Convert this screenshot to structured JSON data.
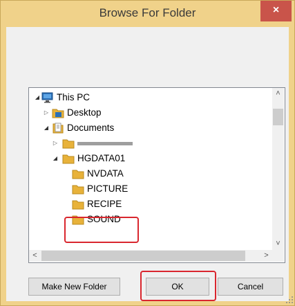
{
  "dialog": {
    "title": "Browse For Folder",
    "close_label": "×",
    "accent_color": "#f0d28a",
    "highlight_color": "#d9262e"
  },
  "tree": {
    "items": [
      {
        "label": "This PC",
        "icon": "pc-icon",
        "toggle": "expanded"
      },
      {
        "label": "Desktop",
        "icon": "desktop-folder-icon",
        "toggle": "collapsed"
      },
      {
        "label": "Documents",
        "icon": "documents-icon",
        "toggle": "expanded"
      },
      {
        "label": "",
        "icon": "folder-icon",
        "toggle": "collapsed",
        "redacted": true
      },
      {
        "label": "HGDATA01",
        "icon": "folder-icon",
        "toggle": "expanded"
      },
      {
        "label": "NVDATA",
        "icon": "folder-icon",
        "toggle": "none"
      },
      {
        "label": "PICTURE",
        "icon": "folder-icon",
        "toggle": "none"
      },
      {
        "label": "RECIPE",
        "icon": "folder-icon",
        "toggle": "none",
        "highlighted": true
      },
      {
        "label": "SOUND",
        "icon": "folder-icon",
        "toggle": "none"
      }
    ]
  },
  "scroll": {
    "up": "˄",
    "down": "˅",
    "left": "<",
    "right": ">"
  },
  "buttons": {
    "make_new_folder": "Make New Folder",
    "ok": "OK",
    "cancel": "Cancel"
  }
}
